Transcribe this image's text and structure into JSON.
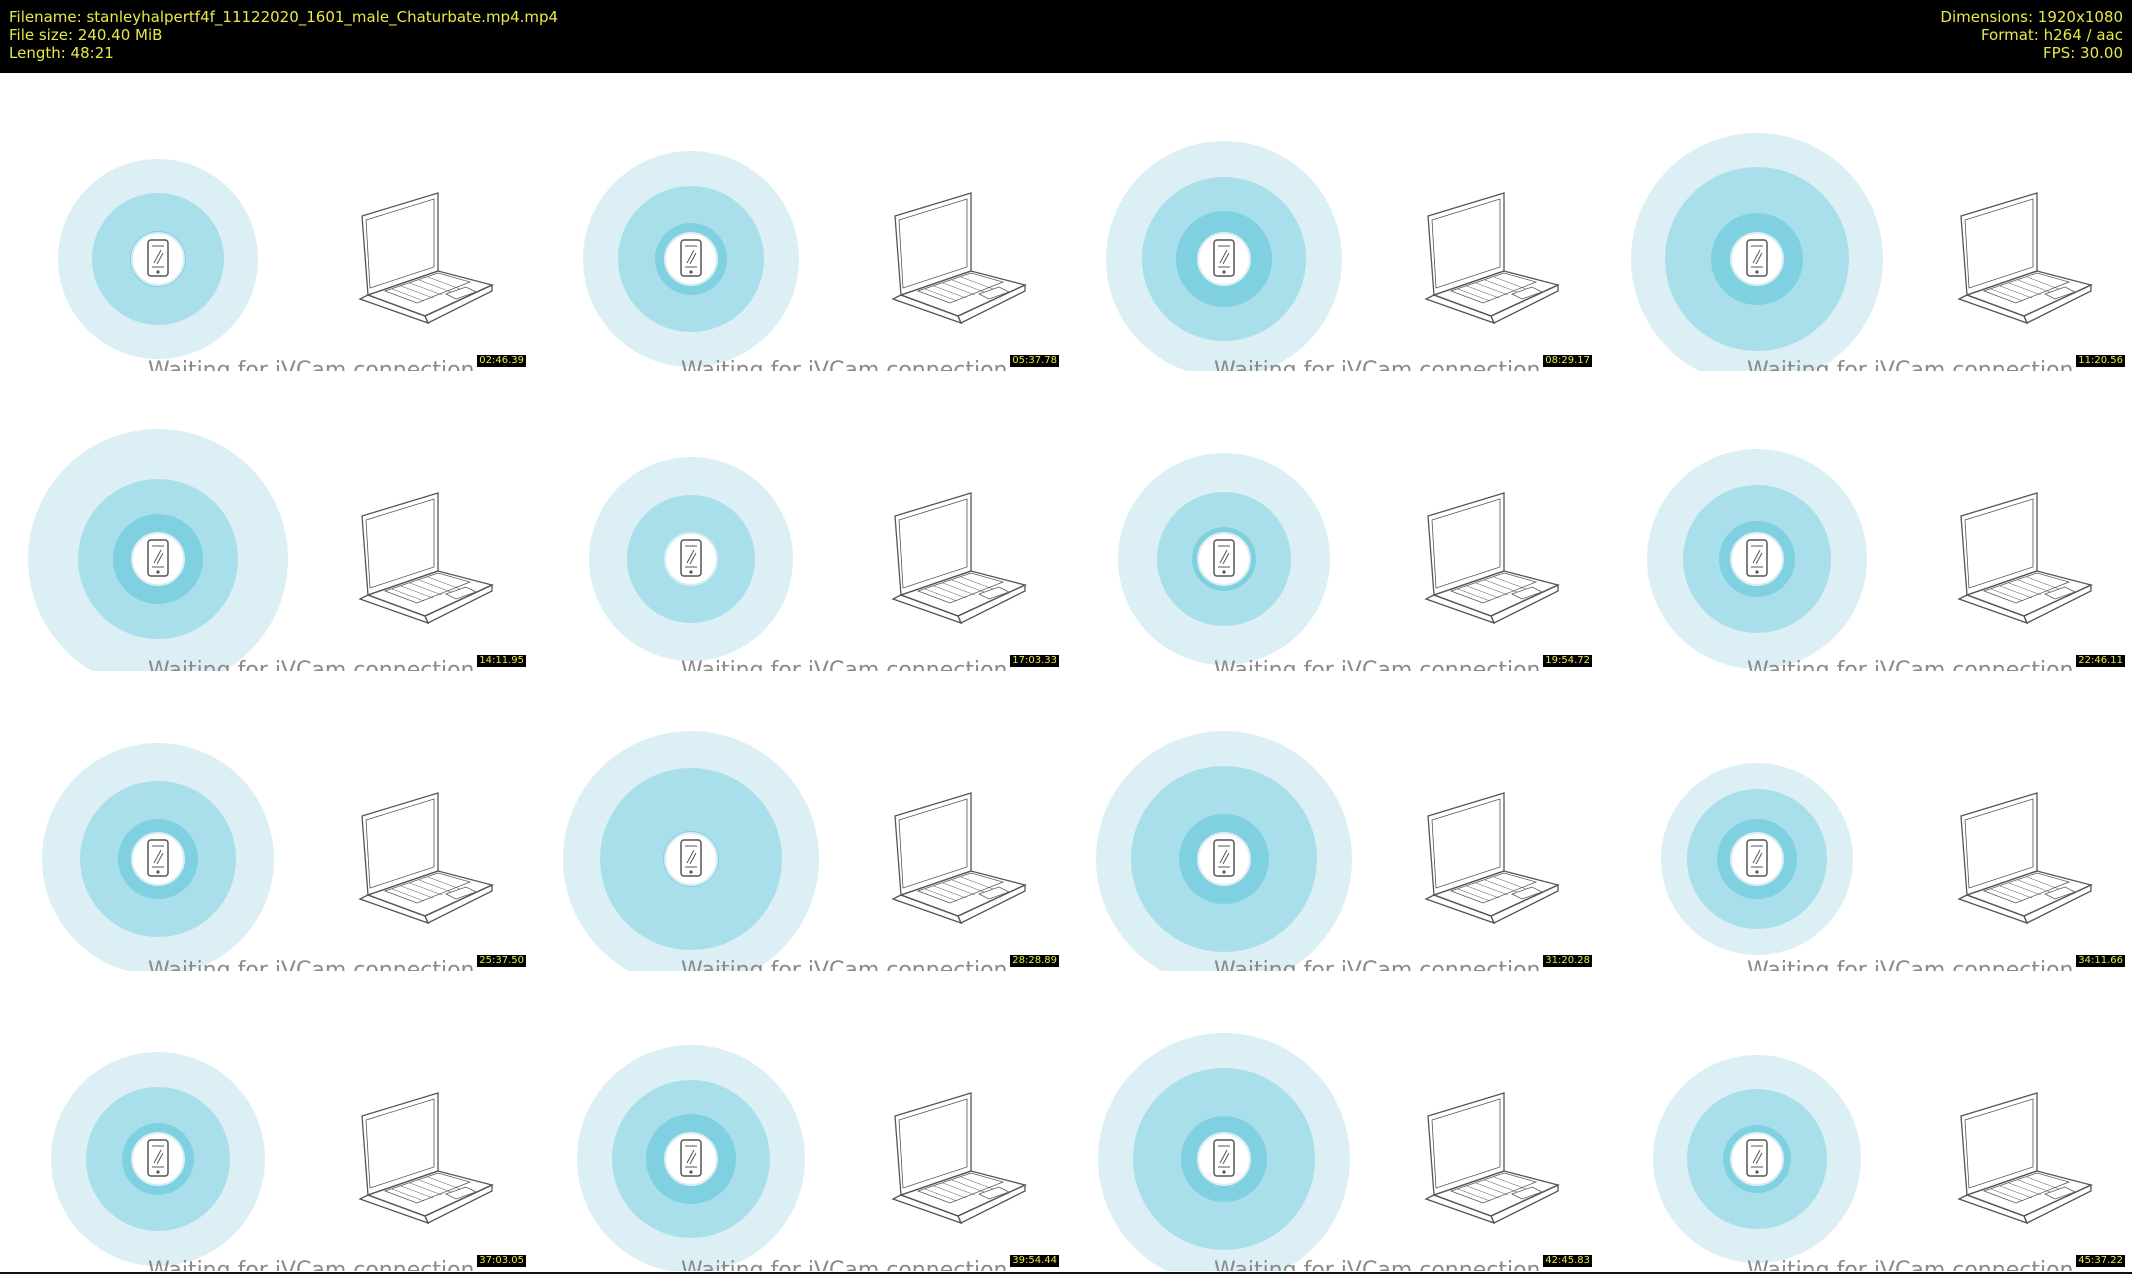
{
  "header": {
    "filename": "Filename: stanleyhalpertf4f_11122020_1601_male_Chaturbate.mp4.mp4",
    "filesize": "File size: 240.40 MiB",
    "length": "Length: 48:21",
    "dimensions": "Dimensions: 1920x1080",
    "format": "Format: h264 / aac",
    "fps": "FPS: 30.00"
  },
  "thumbnails": [
    {
      "caption": "Waiting for iVCam connection",
      "timestamp": "02:46.39"
    },
    {
      "caption": "Waiting for iVCam connection",
      "timestamp": "05:37.78"
    },
    {
      "caption": "Waiting for iVCam connection",
      "timestamp": "08:29.17"
    },
    {
      "caption": "Waiting for iVCam connection",
      "timestamp": "11:20.56"
    },
    {
      "caption": "Waiting for iVCam connection",
      "timestamp": "14:11.95"
    },
    {
      "caption": "Waiting for iVCam connection",
      "timestamp": "17:03.33"
    },
    {
      "caption": "Waiting for iVCam connection",
      "timestamp": "19:54.72"
    },
    {
      "caption": "Waiting for iVCam connection",
      "timestamp": "22:46.11"
    },
    {
      "caption": "Waiting for iVCam connection",
      "timestamp": "25:37.50"
    },
    {
      "caption": "Waiting for iVCam connection",
      "timestamp": "28:28.89"
    },
    {
      "caption": "Waiting for iVCam connection",
      "timestamp": "31:20.28"
    },
    {
      "caption": "Waiting for iVCam connection",
      "timestamp": "34:11.66"
    },
    {
      "caption": "Waiting for iVCam connection",
      "timestamp": "37:03.05"
    },
    {
      "caption": "Waiting for iVCam connection",
      "timestamp": "39:54.44"
    },
    {
      "caption": "Waiting for iVCam connection",
      "timestamp": "42:45.83"
    },
    {
      "caption": "Waiting for iVCam connection",
      "timestamp": "45:37.22"
    }
  ],
  "colors": {
    "header_bg": "#000000",
    "header_text": "#e8e84a",
    "ring_outer": "#dbeff5",
    "ring_mid": "#a9dfea",
    "ring_inner": "#7fd0e0",
    "caption_text": "#8a8a8a"
  },
  "icons": [
    "phone-icon",
    "laptop-icon"
  ]
}
